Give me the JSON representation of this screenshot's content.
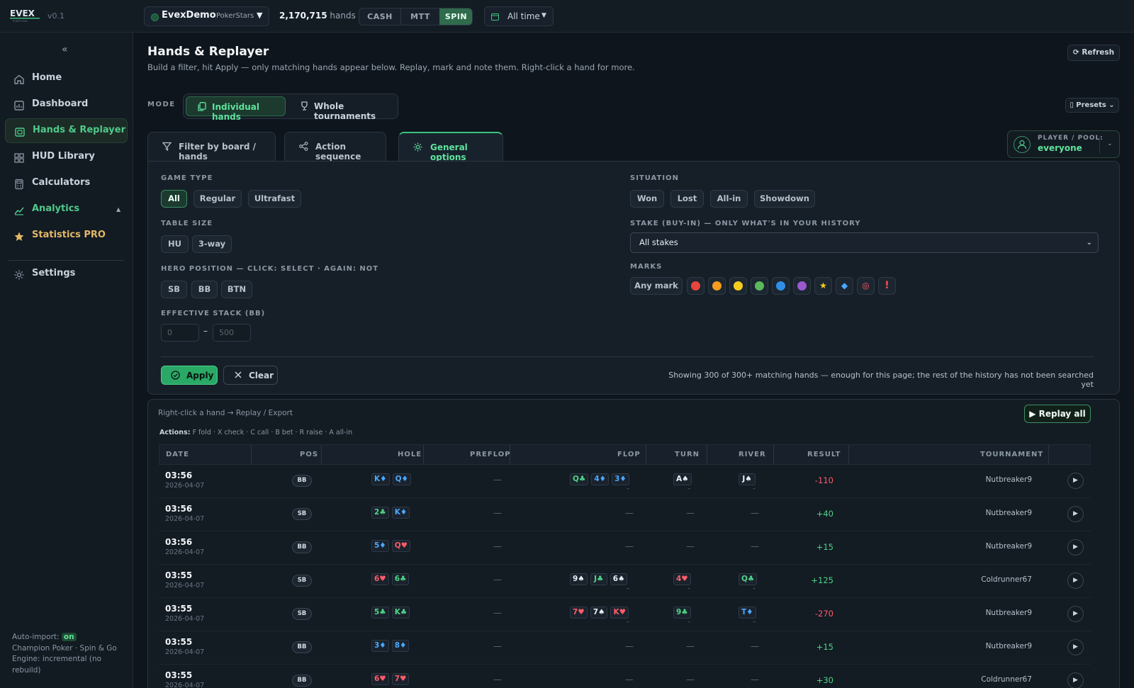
{
  "app": {
    "logo_text": "EVEX",
    "logo_sub": "POKER HUD",
    "version": "v0.1"
  },
  "topbar": {
    "account_name": "EvexDemo",
    "account_site": "PokerStars",
    "hands_count": "2,170,715",
    "hands_label": "hands",
    "segments": [
      "CASH",
      "MTT",
      "SPIN"
    ],
    "active_segment": "SPIN",
    "time_range": "All time"
  },
  "sidebar": {
    "collapse": "«",
    "items": [
      {
        "label": "Home",
        "icon": "home-icon"
      },
      {
        "label": "Dashboard",
        "icon": "dashboard-icon"
      },
      {
        "label": "Hands & Replayer",
        "icon": "cards-icon"
      },
      {
        "label": "HUD Library",
        "icon": "grid-icon"
      },
      {
        "label": "Calculators",
        "icon": "calculator-icon"
      },
      {
        "label": "Analytics",
        "icon": "chart-icon"
      },
      {
        "label": "Statistics PRO",
        "icon": "star-icon"
      },
      {
        "label": "Settings",
        "icon": "gear-icon"
      }
    ],
    "footer": {
      "autoimport_label": "Auto-import:",
      "autoimport_value": "on",
      "line2": "Champion Poker · Spin & Go",
      "line3": "Engine: incremental (no rebuild)"
    }
  },
  "page": {
    "title": "Hands & Replayer",
    "subtitle": "Build a filter, hit Apply — only matching hands appear below. Replay, mark and note them. Right-click a hand for more.",
    "refresh": "⟳ Refresh",
    "mode_label": "MODE",
    "mode_individual": "Individual hands",
    "mode_tournaments": "Whole tournaments",
    "presets": "Presets",
    "tabs": [
      "Filter by board / hands",
      "Action sequence",
      "General options"
    ],
    "pool_label": "PLAYER / POOL:",
    "pool_value": "everyone"
  },
  "filters": {
    "game_type_label": "GAME TYPE",
    "game_types": [
      "All",
      "Regular",
      "Ultrafast"
    ],
    "table_size_label": "TABLE SIZE",
    "table_sizes": [
      "HU",
      "3-way"
    ],
    "hero_pos_label": "HERO POSITION — CLICK: SELECT · AGAIN: NOT",
    "hero_positions": [
      "SB",
      "BB",
      "BTN"
    ],
    "eff_stack_label": "EFFECTIVE STACK (BB)",
    "eff_min_placeholder": "0",
    "eff_max_placeholder": "500",
    "eff_sep": "–",
    "situation_label": "SITUATION",
    "situations": [
      "Won",
      "Lost",
      "All-in",
      "Showdown"
    ],
    "stake_label": "STAKE (BUY-IN) — ONLY WHAT'S IN YOUR HISTORY",
    "stake_value": "All stakes",
    "marks_label": "MARKS",
    "any_mark": "Any mark",
    "mark_colors": [
      "#e8453c",
      "#f39c1e",
      "#f5cc1e",
      "#5cb85c",
      "#2f8fe6",
      "#9b59d0"
    ],
    "mark_icons": [
      "⭐",
      "🐟",
      "🎯",
      "❗"
    ],
    "apply": "Apply",
    "clear": "Clear",
    "showing": "Showing 300 of 300+ matching hands — enough for this page; the rest of the history has not been searched yet"
  },
  "table": {
    "hint": "Right-click a hand → Replay / Export",
    "replay_all": "▶ Replay all",
    "actions_label": "Actions:",
    "actions_text": "F fold · X check · C call · B bet · R raise · A all-in",
    "columns": [
      "DATE",
      "POS",
      "HOLE",
      "PREFLOP",
      "FLOP",
      "TURN",
      "RIVER",
      "RESULT",
      "TOURNAMENT"
    ],
    "rows": [
      {
        "time": "03:56",
        "date": "2026-04-07",
        "pos": "BB",
        "hole": [
          {
            "r": "K♦",
            "s": "di"
          },
          {
            "r": "Q♦",
            "s": "di"
          }
        ],
        "preflop": "—",
        "flop": [
          {
            "r": "Q♣",
            "s": "cl"
          },
          {
            "r": "4♦",
            "s": "di"
          },
          {
            "r": "3♦",
            "s": "di"
          }
        ],
        "turn": [
          {
            "r": "A♠",
            "s": "sp"
          }
        ],
        "river": [
          {
            "r": "J♠",
            "s": "sp"
          }
        ],
        "result": "-110",
        "tournament": "Nutbreaker9"
      },
      {
        "time": "03:56",
        "date": "2026-04-07",
        "pos": "SB",
        "hole": [
          {
            "r": "2♣",
            "s": "cl"
          },
          {
            "r": "K♦",
            "s": "di"
          }
        ],
        "preflop": "—",
        "flop": [],
        "turn": [],
        "river": [],
        "result": "+40",
        "tournament": "Nutbreaker9"
      },
      {
        "time": "03:56",
        "date": "2026-04-07",
        "pos": "BB",
        "hole": [
          {
            "r": "5♦",
            "s": "di"
          },
          {
            "r": "Q♥",
            "s": "he"
          }
        ],
        "preflop": "—",
        "flop": [],
        "turn": [],
        "river": [],
        "result": "+15",
        "tournament": "Nutbreaker9"
      },
      {
        "time": "03:55",
        "date": "2026-04-07",
        "pos": "SB",
        "hole": [
          {
            "r": "6♥",
            "s": "he"
          },
          {
            "r": "6♣",
            "s": "cl"
          }
        ],
        "preflop": "—",
        "flop": [
          {
            "r": "9♠",
            "s": "sp"
          },
          {
            "r": "J♣",
            "s": "cl"
          },
          {
            "r": "6♠",
            "s": "sp"
          }
        ],
        "turn": [
          {
            "r": "4♥",
            "s": "he"
          }
        ],
        "river": [
          {
            "r": "Q♣",
            "s": "cl"
          }
        ],
        "result": "+125",
        "tournament": "Coldrunner67"
      },
      {
        "time": "03:55",
        "date": "2026-04-07",
        "pos": "SB",
        "hole": [
          {
            "r": "5♣",
            "s": "cl"
          },
          {
            "r": "K♣",
            "s": "cl"
          }
        ],
        "preflop": "—",
        "flop": [
          {
            "r": "7♥",
            "s": "he"
          },
          {
            "r": "7♠",
            "s": "sp"
          },
          {
            "r": "K♥",
            "s": "he"
          }
        ],
        "turn": [
          {
            "r": "9♣",
            "s": "cl"
          }
        ],
        "river": [
          {
            "r": "T♦",
            "s": "di"
          }
        ],
        "result": "-270",
        "tournament": "Nutbreaker9"
      },
      {
        "time": "03:55",
        "date": "2026-04-07",
        "pos": "BB",
        "hole": [
          {
            "r": "3♦",
            "s": "di"
          },
          {
            "r": "8♦",
            "s": "di"
          }
        ],
        "preflop": "—",
        "flop": [],
        "turn": [],
        "river": [],
        "result": "+15",
        "tournament": "Nutbreaker9"
      },
      {
        "time": "03:55",
        "date": "2026-04-07",
        "pos": "BB",
        "hole": [
          {
            "r": "6♥",
            "s": "he"
          },
          {
            "r": "7♥",
            "s": "he"
          }
        ],
        "preflop": "—",
        "flop": [],
        "turn": [],
        "river": [],
        "result": "+30",
        "tournament": "Coldrunner67"
      }
    ],
    "empty": "—",
    "sub_mark": "–",
    "play": "▶"
  }
}
